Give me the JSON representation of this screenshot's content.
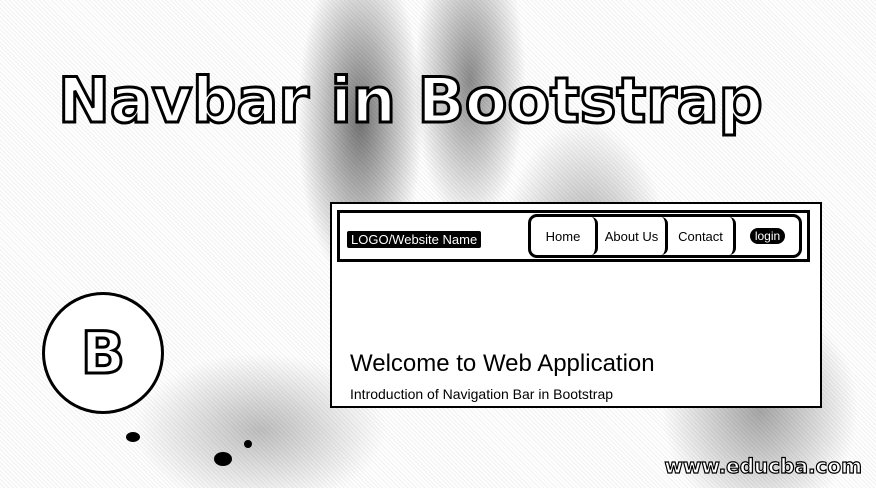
{
  "page": {
    "title": "Navbar in Bootstrap",
    "logo_letter": "B",
    "watermark": "www.educba.com"
  },
  "demo": {
    "navbar": {
      "brand": "LOGO/Website Name",
      "items": [
        {
          "label": "Home"
        },
        {
          "label": "About Us"
        },
        {
          "label": "Contact"
        },
        {
          "label": "login"
        }
      ]
    },
    "heading": "Welcome to Web Application",
    "subheading": "Introduction of Navigation Bar in Bootstrap"
  }
}
